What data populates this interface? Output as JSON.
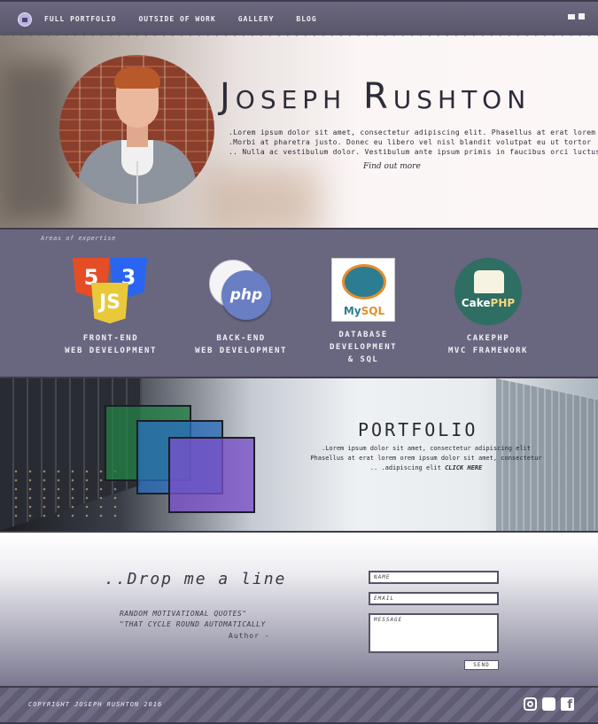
{
  "nav": {
    "links": [
      "Full Portfolio",
      "Outside of Work",
      "Gallery",
      "Blog"
    ]
  },
  "hero": {
    "name": "Joseph Rushton",
    "lorem_lines": [
      ".Lorem ipsum dolor sit amet, consectetur adipiscing elit. Phasellus at erat lorem",
      ".Morbi at pharetra justo. Donec eu libero vel nisl blandit volutpat eu ut tortor",
      ".. Nulla ac vestibulum dolor. Vestibulum ante ipsum primis in faucibus orci luctus"
    ],
    "find_out_more": "Find out more"
  },
  "expertise": {
    "heading": "Areas of expertise",
    "skills": [
      {
        "line1": "Front-End",
        "line2": "Web Development",
        "line3": ""
      },
      {
        "line1": "Back-End",
        "line2": "Web Development",
        "line3": ""
      },
      {
        "line1": "Database",
        "line2": "Development",
        "line3": "& SQL"
      },
      {
        "line1": "CakePHP",
        "line2": "MVC Framework",
        "line3": ""
      }
    ],
    "icons": {
      "html5": "5",
      "css3": "3",
      "js": "JS",
      "php": "php",
      "mysql_a": "My",
      "mysql_b": "SQL",
      "cake_a": "Cake",
      "cake_b": "PHP"
    }
  },
  "portfolio": {
    "title": "Portfolio",
    "lines": [
      ".Lorem ipsum dolor sit amet, consectetur adipiscing elit",
      "Phasellus at erat lorem orem ipsum dolor sit amet, consectetur",
      ".. .adipiscing elit "
    ],
    "click": "CLICK HERE"
  },
  "contact": {
    "heading": "..Drop me a line",
    "quote_line1": "random motivational quotes\"",
    "quote_line2": "\"that cycle round automatically",
    "author": "Author -",
    "name_placeholder": "Name",
    "email_placeholder": "Email",
    "message_placeholder": "Message",
    "send_label": "Send"
  },
  "footer": {
    "copyright": "Copyright Joseph Rushton 2016"
  },
  "colors": {
    "nav": "#575468",
    "section": "#69667f",
    "accent_text": "#2e2c3a"
  }
}
